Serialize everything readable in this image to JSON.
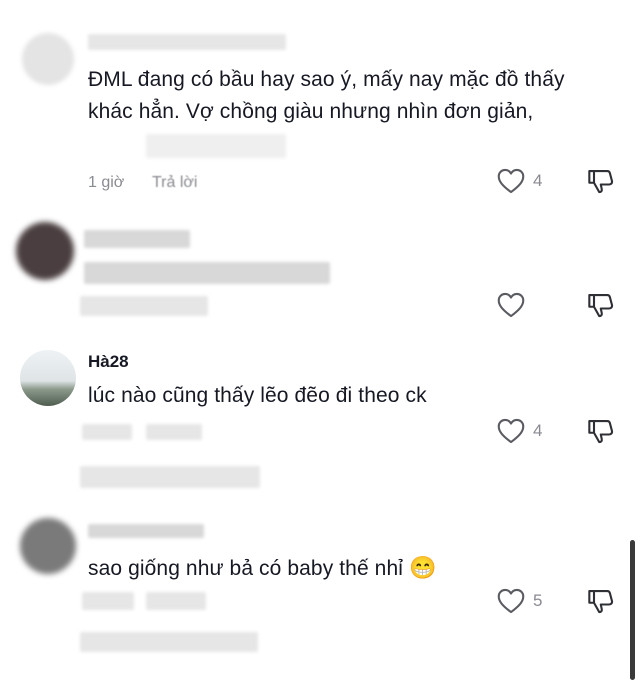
{
  "comments": [
    {
      "username": "",
      "text": "ĐML đang có bầu hay sao ý, mấy nay mặc đồ thấy khác hẳn. Vợ chồng giàu nhưng nhìn đơn giản,",
      "time": "1 giờ",
      "reply_label": "Trả lời",
      "likes": "4"
    },
    {
      "username": "",
      "text": "",
      "time": "",
      "reply_label": "",
      "likes": ""
    },
    {
      "username": "Hà28",
      "text": "lúc nào cũng thấy lẽo đẽo đi theo ck",
      "time": "",
      "reply_label": "",
      "likes": "4"
    },
    {
      "username": "",
      "text": "sao giống như bả có baby thế nhỉ",
      "emoji": "😁",
      "time": "",
      "reply_label": "",
      "likes": "5"
    }
  ],
  "icons": {
    "like": "heart-outline-icon",
    "dislike": "thumbs-down-icon"
  }
}
